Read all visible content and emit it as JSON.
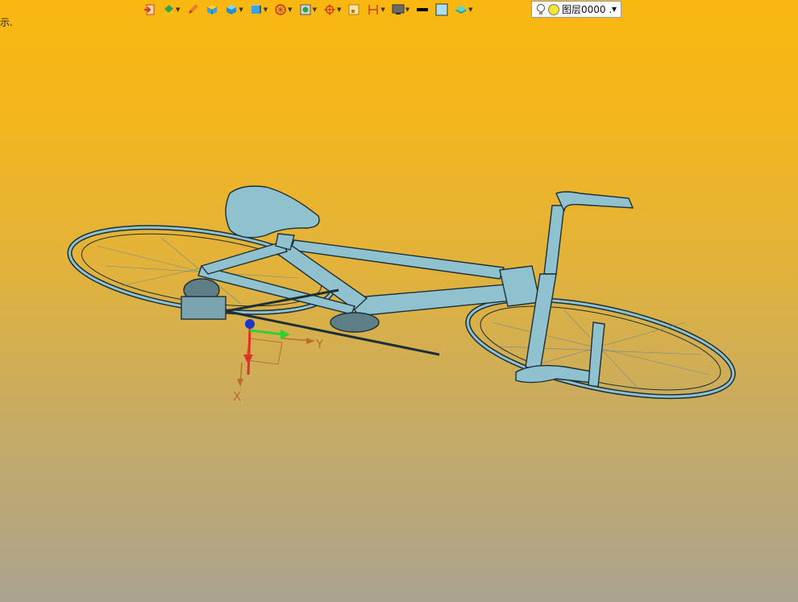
{
  "status": {
    "text": "示."
  },
  "toolbar": {
    "items": [
      {
        "icon": "exit-icon",
        "dropdown": false
      },
      {
        "icon": "paint-bucket-icon",
        "dropdown": true
      },
      {
        "icon": "pencil-icon",
        "dropdown": false
      },
      {
        "icon": "cube-icon",
        "dropdown": false
      },
      {
        "icon": "solid-cube-icon",
        "dropdown": true
      },
      {
        "icon": "view-cube-icon",
        "dropdown": true
      },
      {
        "icon": "render-sphere-icon",
        "dropdown": true
      },
      {
        "icon": "section-view-icon",
        "dropdown": true
      },
      {
        "icon": "snap-target-icon",
        "dropdown": true
      },
      {
        "icon": "frame-icon",
        "dropdown": false
      },
      {
        "icon": "dimension-icon",
        "dropdown": true
      },
      {
        "icon": "monitor-icon",
        "dropdown": true
      },
      {
        "icon": "line-color-icon",
        "dropdown": false
      },
      {
        "icon": "fill-color-icon",
        "dropdown": false
      },
      {
        "icon": "layer-stack-icon",
        "dropdown": true
      }
    ],
    "colors": {
      "line": "#000000",
      "fill": "#a9e0f5"
    }
  },
  "layer": {
    "name": "图层0000 ."
  },
  "viewport": {
    "model": "bicycle",
    "model_color": "#8fc1cf",
    "axes": {
      "x_label": "X",
      "y_label": "Y"
    }
  }
}
